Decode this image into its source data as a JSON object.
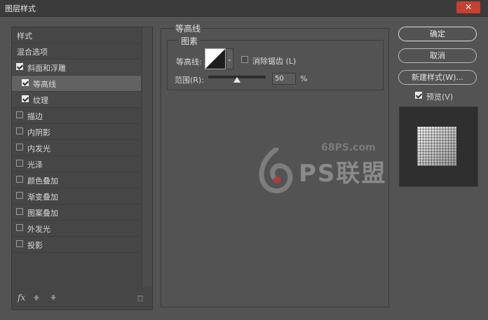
{
  "window": {
    "title": "图层样式",
    "close_glyph": "✕"
  },
  "left": {
    "header": "样式",
    "blend": "混合选项",
    "items": [
      {
        "label": "斜面和浮雕",
        "checked": true,
        "plus": false
      },
      {
        "label": "等高线",
        "checked": true,
        "plus": false
      },
      {
        "label": "纹理",
        "checked": true,
        "plus": false
      },
      {
        "label": "描边",
        "checked": false,
        "plus": true
      },
      {
        "label": "内阴影",
        "checked": false,
        "plus": true
      },
      {
        "label": "内发光",
        "checked": false,
        "plus": false
      },
      {
        "label": "光泽",
        "checked": false,
        "plus": false
      },
      {
        "label": "颜色叠加",
        "checked": false,
        "plus": true
      },
      {
        "label": "渐变叠加",
        "checked": false,
        "plus": true
      },
      {
        "label": "图案叠加",
        "checked": false,
        "plus": false
      },
      {
        "label": "外发光",
        "checked": false,
        "plus": false
      },
      {
        "label": "投影",
        "checked": false,
        "plus": true
      }
    ],
    "toolbar": {
      "fx": "fx",
      "up_icon": "arrow-up-icon",
      "down_icon": "arrow-down-icon",
      "trash_icon": "trash-icon"
    },
    "plus_glyph": "+"
  },
  "contour_panel": {
    "section": "等高线",
    "group": "图素",
    "contour_label": "等高线:",
    "antialias_label": "消除锯齿 (L)",
    "antialias_checked": false,
    "range_label": "范围(R):",
    "range_value": "50",
    "range_unit": "%",
    "dropdown_glyph": "⌄"
  },
  "watermark": {
    "url": "68PS.com",
    "text": "PS联盟"
  },
  "right": {
    "ok": "确定",
    "cancel": "取消",
    "new_style": "新建样式(W)...",
    "preview_label": "预览(V)",
    "preview_checked": true
  }
}
